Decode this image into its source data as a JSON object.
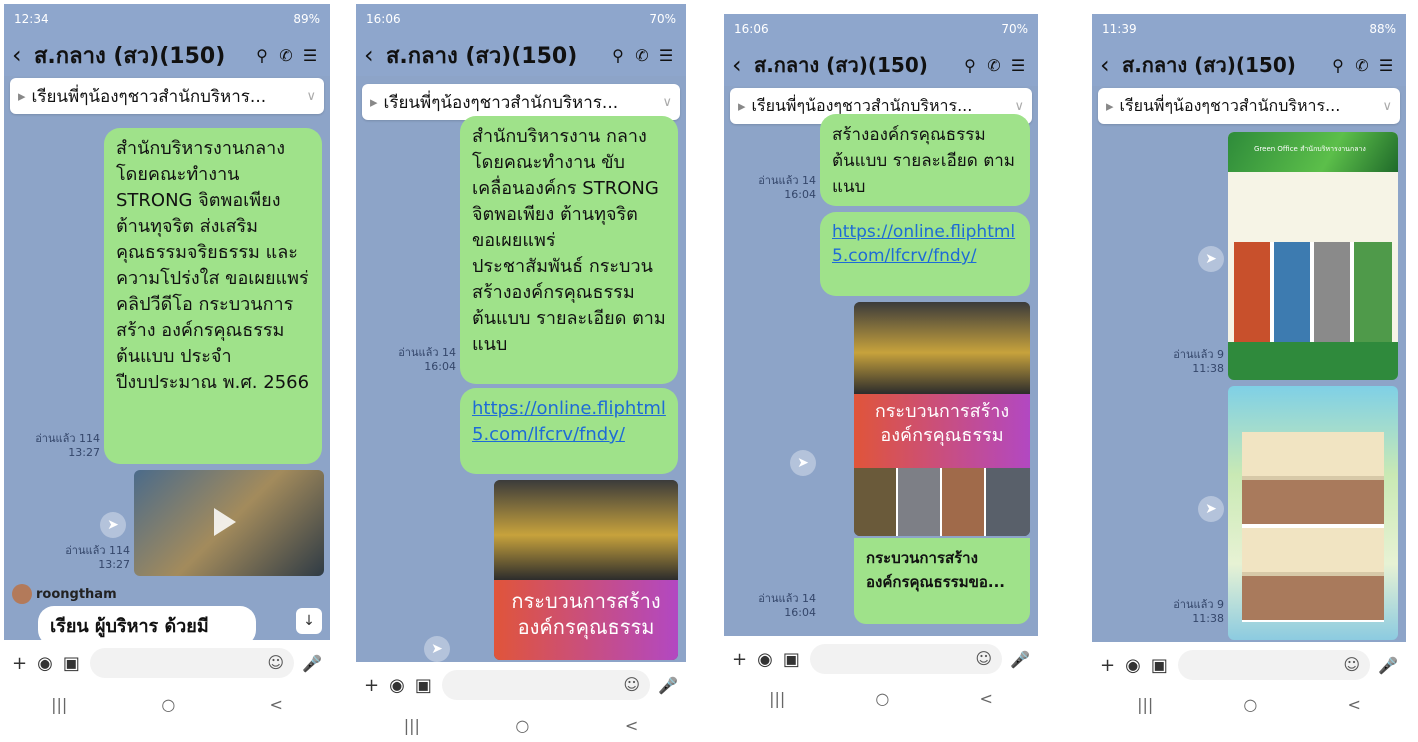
{
  "common": {
    "chat_title": "ส.กลาง (สว)(150)",
    "announcement": "เรียนพี่ๆน้องๆชาวสำนักบริหาร...",
    "nav_recent": "|||",
    "nav_home": "○",
    "nav_back": "<"
  },
  "screens": [
    {
      "status_time": "12:34",
      "status_battery": "89%",
      "message1": "สำนักบริหารงานกลาง โดยคณะทำงาน STRONG จิตพอเพียง ต้านทุจริต ส่งเสริม คุณธรรมจริยธรรม และความโปร่งใส ขอเผยแพร่คลิปวีดีโอ กระบวนการสร้าง องค์กรคุณธรรม ต้นแบบ ประจำ ปีงบประมาณ พ.ศ. 2566",
      "meta1_read": "อ่านแล้ว 114",
      "meta1_time": "13:27",
      "meta2_read": "อ่านแล้ว 114",
      "meta2_time": "13:27",
      "sender_name": "roongtham",
      "incoming_text": "เรียน  ผู้บริหาร ด้วยมี"
    },
    {
      "status_time": "16:06",
      "status_battery": "70%",
      "message1": "สำนักบริหารงาน กลาง โดยคณะทำงาน ขับเคลื่อนองค์กร STRONG จิตพอเพียง ต้านทุจริต ขอเผยแพร่ ประชาสัมพันธ์ กระบวน สร้างองค์กรคุณธรรม ต้นแบบ รายละเอียด ตามแนบ",
      "meta1_read": "อ่านแล้ว 14",
      "meta1_time": "16:04",
      "link": "https://online.fliphtml5.com/lfcrv/fndy/",
      "poster_text": "กระบวนการสร้าง องค์กรคุณธรรม"
    },
    {
      "status_time": "16:06",
      "status_battery": "70%",
      "message1": "สร้างองค์กรคุณธรรม ต้นแบบ รายละเอียด ตามแนบ",
      "meta1_read": "อ่านแล้ว 14",
      "meta1_time": "16:04",
      "link": "https://online.fliphtml5.com/lfcrv/fndy/",
      "poster_text": "กระบวนการสร้าง องค์กรคุณธรรม",
      "caption": "กระบวนการสร้าง องค์กรคุณธรรมขอ...",
      "meta2_read": "อ่านแล้ว 14",
      "meta2_time": "16:04"
    },
    {
      "status_time": "11:39",
      "status_battery": "88%",
      "poster1_title": "Green Office สำนักบริหารงานกลาง",
      "meta1_read": "อ่านแล้ว 9",
      "meta1_time": "11:38",
      "meta2_read": "อ่านแล้ว 9",
      "meta2_time": "11:38"
    }
  ]
}
